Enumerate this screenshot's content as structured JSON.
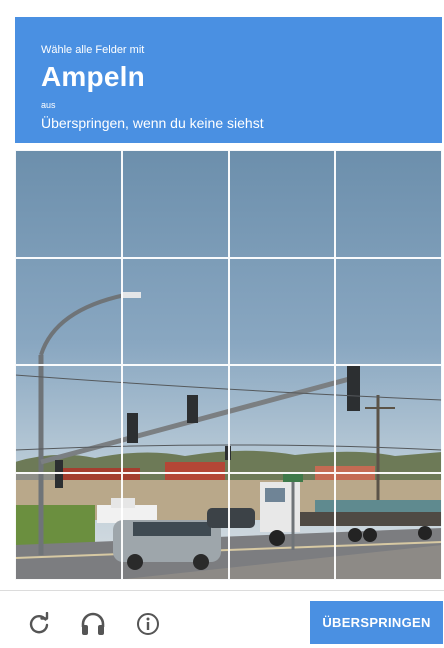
{
  "header": {
    "instruction": "Wähle alle Felder mit",
    "target": "Ampeln",
    "suffix": "aus",
    "skip_hint": "Überspringen, wenn du keine siehst"
  },
  "grid": {
    "rows": 4,
    "columns": 4
  },
  "footer": {
    "reload_icon": "reload-icon",
    "audio_icon": "headphones-icon",
    "info_icon": "info-icon",
    "skip_label": "ÜBERSPRINGEN"
  },
  "colors": {
    "accent": "#4a90e2",
    "icon": "#555555"
  }
}
